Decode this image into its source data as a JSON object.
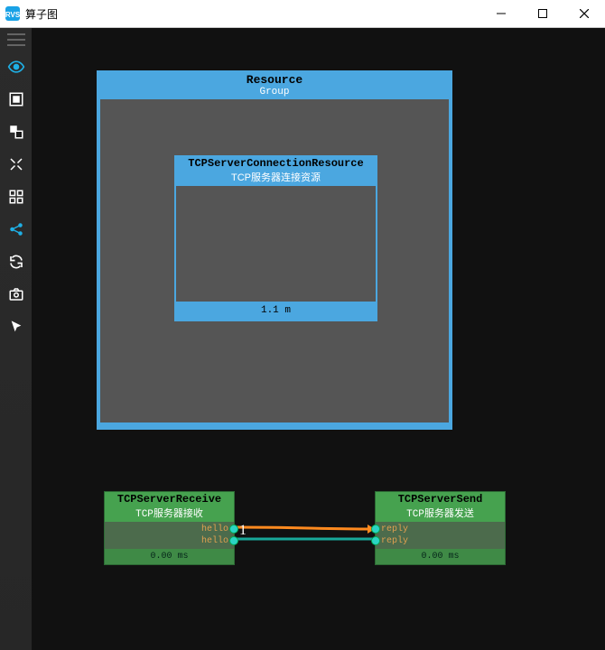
{
  "window": {
    "title": "算子图"
  },
  "group": {
    "title": "Resource",
    "subtitle": "Group"
  },
  "resource": {
    "title": "TCPServerConnectionResource",
    "subtitle": "TCP服务器连接资源",
    "footer": "1.1 m"
  },
  "node_receive": {
    "title": "TCPServerReceive",
    "subtitle": "TCP服务器接收",
    "out1": "hello",
    "out2": "hello",
    "footer": "0.00 ms"
  },
  "node_send": {
    "title": "TCPServerSend",
    "subtitle": "TCP服务器发送",
    "in1": "reply",
    "in2": "reply",
    "footer": "0.00 ms"
  },
  "link_label": "1"
}
